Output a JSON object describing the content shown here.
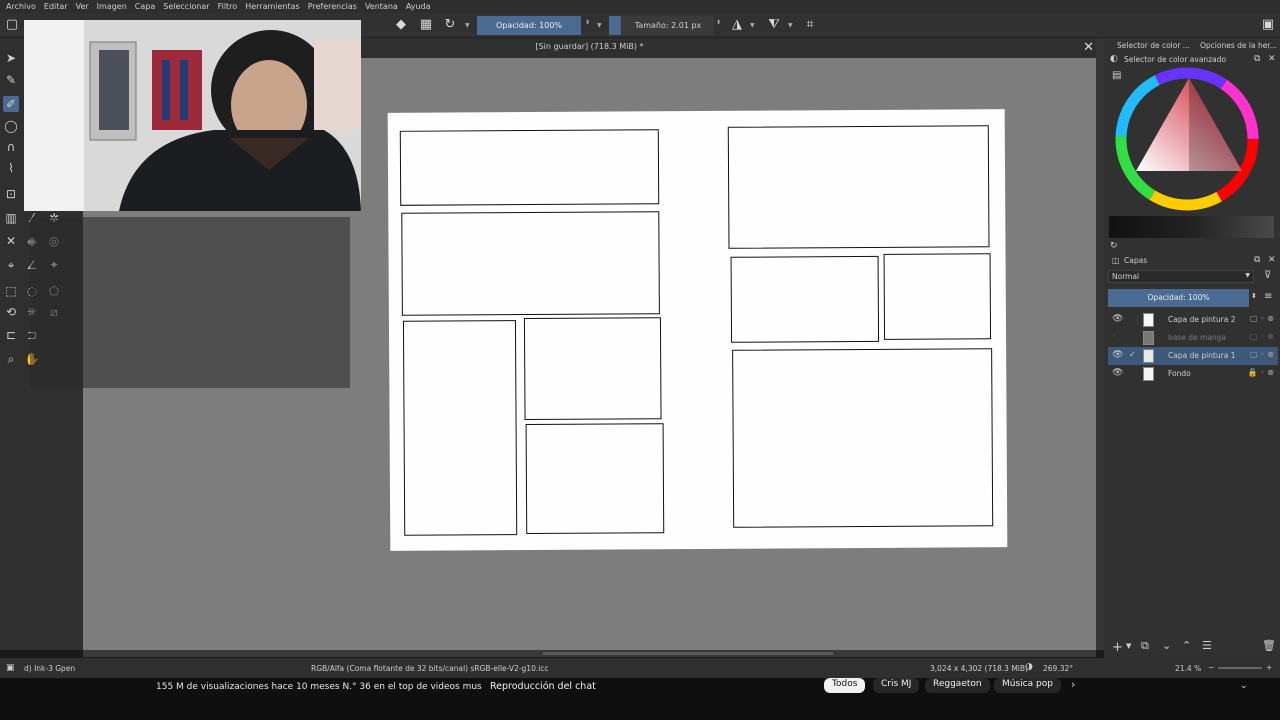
{
  "menu": [
    "Archivo",
    "Editar",
    "Ver",
    "Imagen",
    "Capa",
    "Seleccionar",
    "Filtro",
    "Herramientas",
    "Preferencias",
    "Ventana",
    "Ayuda"
  ],
  "tool_options": {
    "opacity": "Opacidad: 100%",
    "size": "Tamaño: 2.01 px"
  },
  "document": {
    "title": "[Sin guardar]  (718.3 MiB) *"
  },
  "docker": {
    "tab_color": "Selector de color ...",
    "tab_options": "Opciones de la her...",
    "color_title": "Selector de color avanzado",
    "layers_title": "Capas",
    "blend_mode": "Normal",
    "opacity": "Opacidad:  100%",
    "layers": [
      {
        "name": "Capa de pintura 2",
        "visible": true,
        "selected": false
      },
      {
        "name": "base de manga",
        "visible": false,
        "selected": false
      },
      {
        "name": "Capa de pintura 1",
        "visible": true,
        "selected": true
      },
      {
        "name": "Fondo",
        "visible": true,
        "selected": false
      }
    ]
  },
  "status": {
    "brush": "d) Ink-3 Gpen",
    "color_space": "RGB/Alfa (Coma flotante de 32 bits/canal)  sRGB-elle-V2-g10.icc",
    "dimensions": "3,024 x 4,302 (718.3 MiB)",
    "rotation": "269.32°",
    "zoom": "21.4 %"
  },
  "video": {
    "views": "155 M de visualizaciones  hace 10 meses  N.° 36 en el top de videos mus",
    "chat": "Reproducción del chat",
    "chips": [
      "Todos",
      "Cris MJ",
      "Reggaeton",
      "Música pop"
    ]
  }
}
